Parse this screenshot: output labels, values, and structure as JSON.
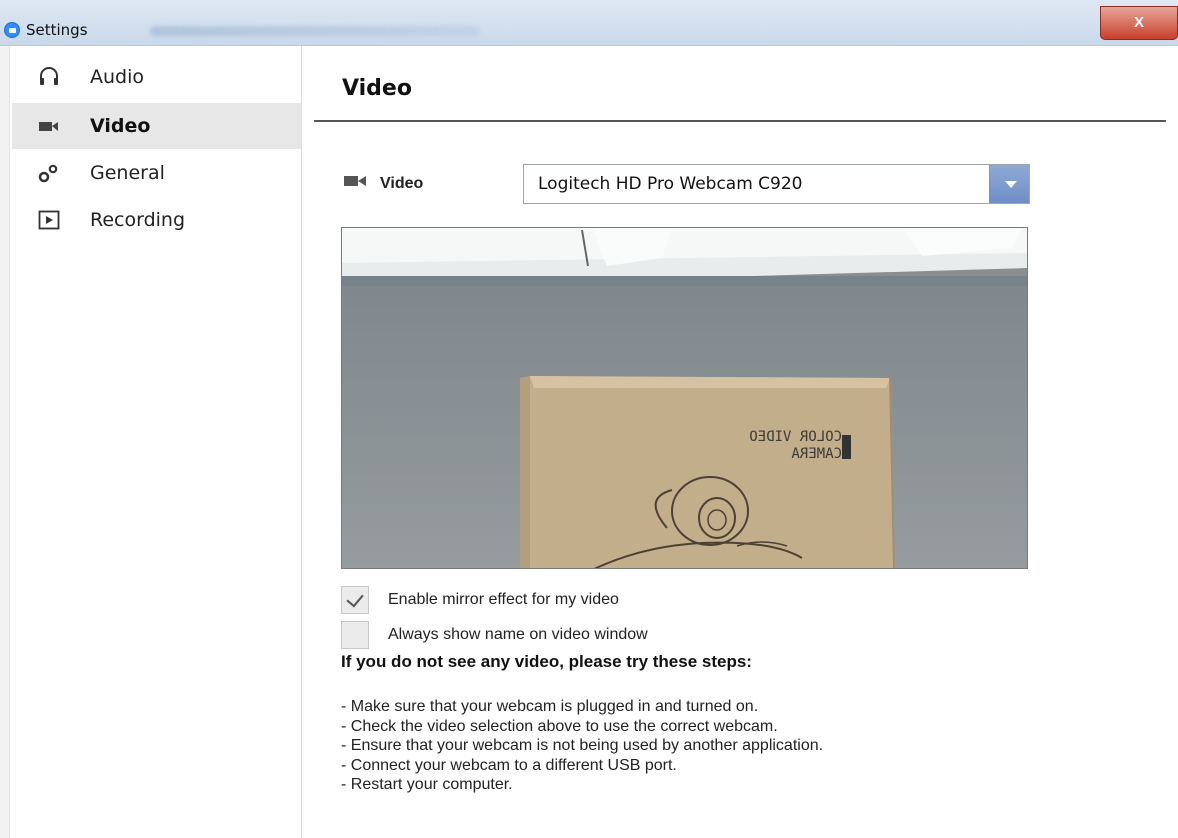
{
  "window": {
    "title": "Settings",
    "close_label": "X"
  },
  "sidebar": {
    "items": [
      {
        "label": "Audio",
        "icon": "headphones-icon"
      },
      {
        "label": "Video",
        "icon": "video-camera-icon"
      },
      {
        "label": "General",
        "icon": "gears-icon"
      },
      {
        "label": "Recording",
        "icon": "play-box-icon"
      }
    ],
    "active": "Video"
  },
  "main": {
    "title": "Video",
    "video_label": "Video",
    "camera_select": {
      "selected": "Logitech HD Pro Webcam C920"
    },
    "preview": {
      "box_text_line1": "COLOR VIDEO",
      "box_text_line2": "CAMERA"
    },
    "options": [
      {
        "label": "Enable mirror effect for my video",
        "checked": true
      },
      {
        "label": "Always show name on video window",
        "checked": false
      }
    ],
    "troubleshoot_title": "If you do not see any video, please try these steps:",
    "troubleshoot_steps": [
      "Make sure that your webcam is plugged in and turned on.",
      "Check the video selection above to use the correct webcam.",
      "Ensure that your webcam is not being used by another application.",
      "Connect your webcam to a different USB port.",
      "Restart your computer."
    ]
  },
  "colors": {
    "titlebar": "#c9d8ea",
    "close_button": "#c7402d",
    "active_nav": "#e7e7e7",
    "dropdown_button": "#6f8fc6"
  }
}
